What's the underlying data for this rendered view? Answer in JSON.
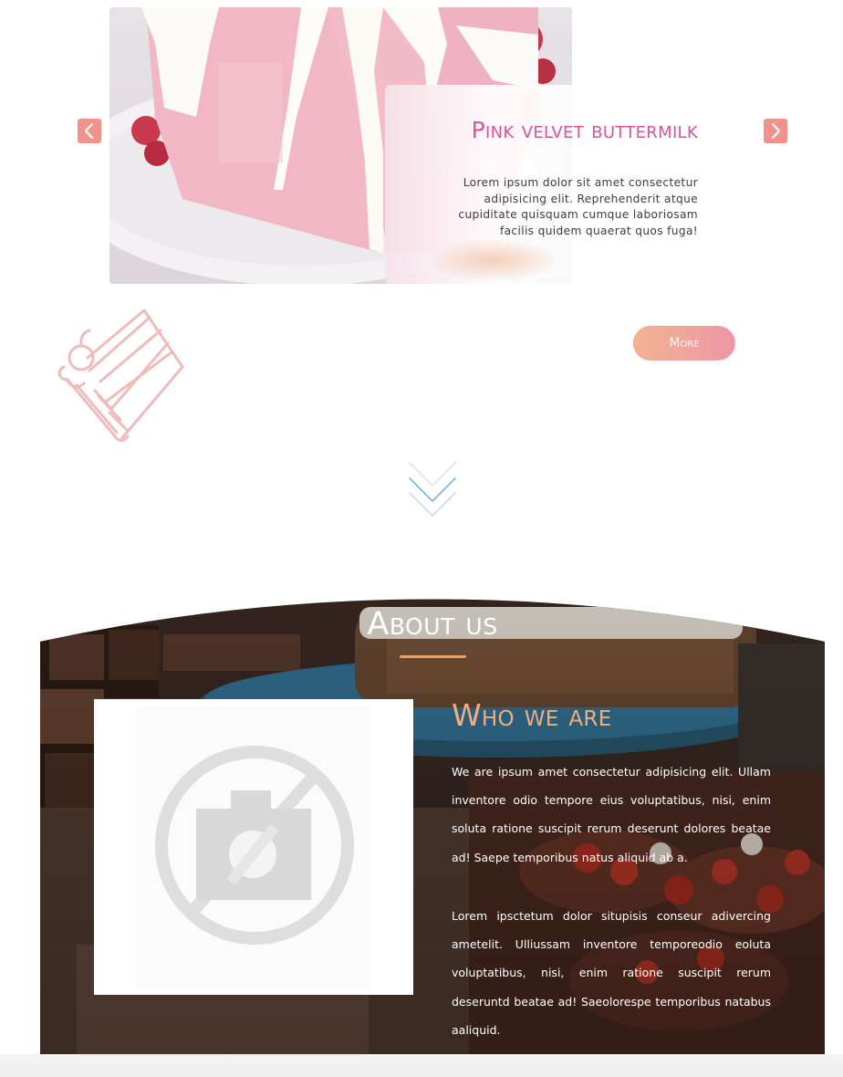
{
  "slider": {
    "title": "Pink velvet buttermilk",
    "description": "Lorem ipsum dolor sit amet consectetur adipisicing elit. Reprehenderit atque cupiditate quisquam cumque laboriosam facilis quidem quaerat quos fuga!",
    "prev_icon": "chevron-left-icon",
    "next_icon": "chevron-right-icon",
    "more_label": "More"
  },
  "logo": {
    "icon": "cake-slice-icon"
  },
  "scroll": {
    "icon": "double-chevron-down-icon"
  },
  "about": {
    "title": "About us",
    "heading": "Who we are",
    "paragraph_1": "We are ipsum amet consectetur adipisicing elit. Ullam inventore odio tempore eius voluptatibus, nisi, enim soluta ratione suscipit rerum deserunt dolores beatae ad! Saepe temporibus natus aliquid ab a.",
    "paragraph_2": "Lorem ipsctetum dolor situpisis conseur adivercing ametelit. Ulliussam inventore temporeodio eoluta voluptatibus, nisi, enim ratione suscipit rerum deseruntd beatae ad! Saeolorespe temporibus natabus aaliquid.",
    "photo_placeholder_icon": "no-photo-icon"
  },
  "colors": {
    "title_pink": "#d9559a",
    "arrow_coral": "#f1938a",
    "accent_peach": "#f0ae7f",
    "logo_pink": "#efbcbc",
    "scroll_blue": "#7eb3df"
  }
}
